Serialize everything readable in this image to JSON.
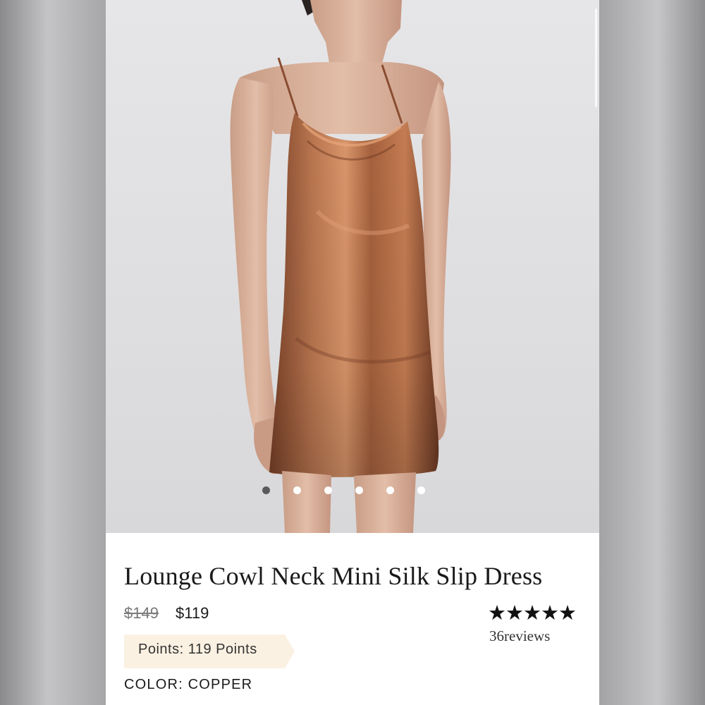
{
  "product": {
    "title": "Lounge Cowl Neck Mini Silk Slip Dress",
    "price_original": "$149",
    "price_sale": "$119",
    "rating_stars": "★★★★★",
    "rating_value": 5,
    "reviews_text": "36reviews",
    "points_text": "Points: 119 Points",
    "color_label": "COLOR:",
    "color_value": "COPPER"
  },
  "gallery": {
    "image_description_icon": "product-photo",
    "total_images": 6,
    "active_index": 0
  },
  "colors": {
    "dress": "#a8684a",
    "points_badge": "#fbf1e2",
    "active_dot": "#5a5a5c"
  }
}
